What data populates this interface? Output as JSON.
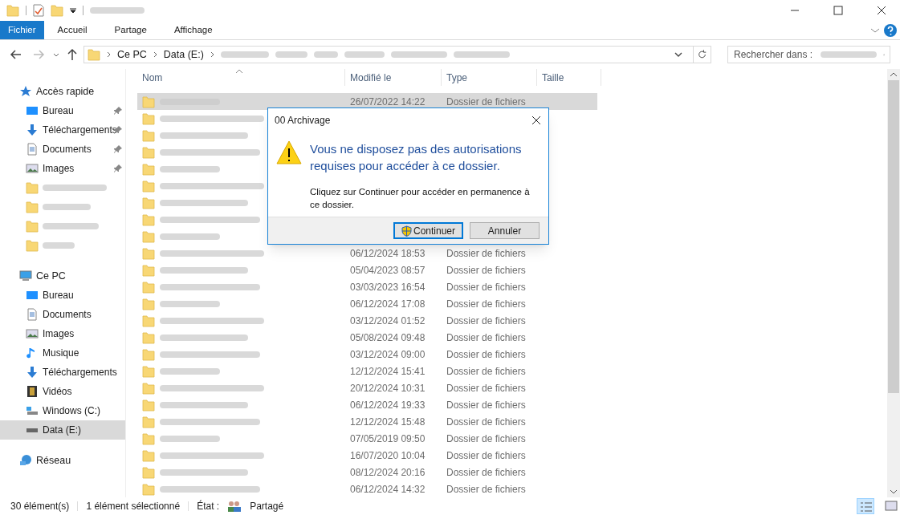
{
  "ribbon": {
    "tabs": [
      {
        "label": "Fichier",
        "selected": true
      },
      {
        "label": "Accueil",
        "selected": false
      },
      {
        "label": "Partage",
        "selected": false
      },
      {
        "label": "Affichage",
        "selected": false
      }
    ]
  },
  "address": {
    "crumbs": [
      "Ce PC",
      "Data (E:)"
    ],
    "search_placeholder": "Rechercher dans :"
  },
  "sidebar": {
    "sections": [
      {
        "label": "Accès rapide",
        "kind": "star",
        "items": [
          {
            "label": "Bureau",
            "kind": "desktop",
            "pinned": true,
            "selected": false
          },
          {
            "label": "Téléchargements",
            "kind": "download",
            "pinned": true,
            "selected": false
          },
          {
            "label": "Documents",
            "kind": "document",
            "pinned": true,
            "selected": false
          },
          {
            "label": "Images",
            "kind": "image",
            "pinned": true,
            "selected": false
          },
          {
            "kind": "folder",
            "pinned": false,
            "selected": false
          },
          {
            "kind": "folder",
            "pinned": false,
            "selected": false
          },
          {
            "kind": "folder",
            "pinned": false,
            "selected": false
          },
          {
            "kind": "folder",
            "pinned": false,
            "selected": false
          }
        ]
      },
      {
        "label": "Ce PC",
        "kind": "pc",
        "items": [
          {
            "label": "Bureau",
            "kind": "desktop",
            "selected": false
          },
          {
            "label": "Documents",
            "kind": "document",
            "selected": false
          },
          {
            "label": "Images",
            "kind": "image",
            "selected": false
          },
          {
            "label": "Musique",
            "kind": "music",
            "selected": false
          },
          {
            "label": "Téléchargements",
            "kind": "download",
            "selected": false
          },
          {
            "label": "Vidéos",
            "kind": "video",
            "selected": false
          },
          {
            "label": "Windows (C:)",
            "kind": "windrive",
            "selected": false
          },
          {
            "label": "Data (E:)",
            "kind": "drive",
            "selected": true
          }
        ]
      },
      {
        "label": "Réseau",
        "kind": "network"
      }
    ]
  },
  "table": {
    "columns": [
      "Nom",
      "Modifié le",
      "Type",
      "Taille"
    ],
    "rows": [
      {
        "selected": true,
        "modified": "26/07/2022 14:22",
        "type": "Dossier de fichiers"
      },
      {
        "selected": false
      },
      {
        "selected": false
      },
      {
        "selected": false
      },
      {
        "selected": false
      },
      {
        "selected": false
      },
      {
        "selected": false
      },
      {
        "selected": false
      },
      {
        "selected": false
      },
      {
        "selected": false,
        "modified": "06/12/2024 18:53",
        "type": "Dossier de fichiers"
      },
      {
        "selected": false,
        "modified": "05/04/2023 08:57",
        "type": "Dossier de fichiers"
      },
      {
        "selected": false,
        "modified": "03/03/2023 16:54",
        "type": "Dossier de fichiers"
      },
      {
        "selected": false,
        "modified": "06/12/2024 17:08",
        "type": "Dossier de fichiers"
      },
      {
        "selected": false,
        "modified": "03/12/2024 01:52",
        "type": "Dossier de fichiers"
      },
      {
        "selected": false,
        "modified": "05/08/2024 09:48",
        "type": "Dossier de fichiers"
      },
      {
        "selected": false,
        "modified": "03/12/2024 09:00",
        "type": "Dossier de fichiers"
      },
      {
        "selected": false,
        "modified": "12/12/2024 15:41",
        "type": "Dossier de fichiers"
      },
      {
        "selected": false,
        "modified": "20/12/2024 10:31",
        "type": "Dossier de fichiers"
      },
      {
        "selected": false,
        "modified": "06/12/2024 19:33",
        "type": "Dossier de fichiers"
      },
      {
        "selected": false,
        "modified": "12/12/2024 15:48",
        "type": "Dossier de fichiers"
      },
      {
        "selected": false,
        "modified": "07/05/2019 09:50",
        "type": "Dossier de fichiers"
      },
      {
        "selected": false,
        "modified": "16/07/2020 10:04",
        "type": "Dossier de fichiers"
      },
      {
        "selected": false,
        "modified": "08/12/2024 20:16",
        "type": "Dossier de fichiers"
      },
      {
        "selected": false,
        "modified": "06/12/2024 14:32",
        "type": "Dossier de fichiers"
      }
    ]
  },
  "dialog": {
    "title": "00 Archivage",
    "heading": "Vous ne disposez pas des autorisations requises pour accéder à ce dossier.",
    "message": "Cliquez sur Continuer pour accéder en permanence à ce dossier.",
    "buttons": [
      {
        "label": "Continuer",
        "default": true,
        "kind": "admin"
      },
      {
        "label": "Annuler",
        "default": false,
        "kind": "plain"
      }
    ]
  },
  "status_bar": {
    "count": "30 élément(s)",
    "selection": "1 élément sélectionné",
    "state_label": "État :",
    "state_value": "Partagé"
  }
}
